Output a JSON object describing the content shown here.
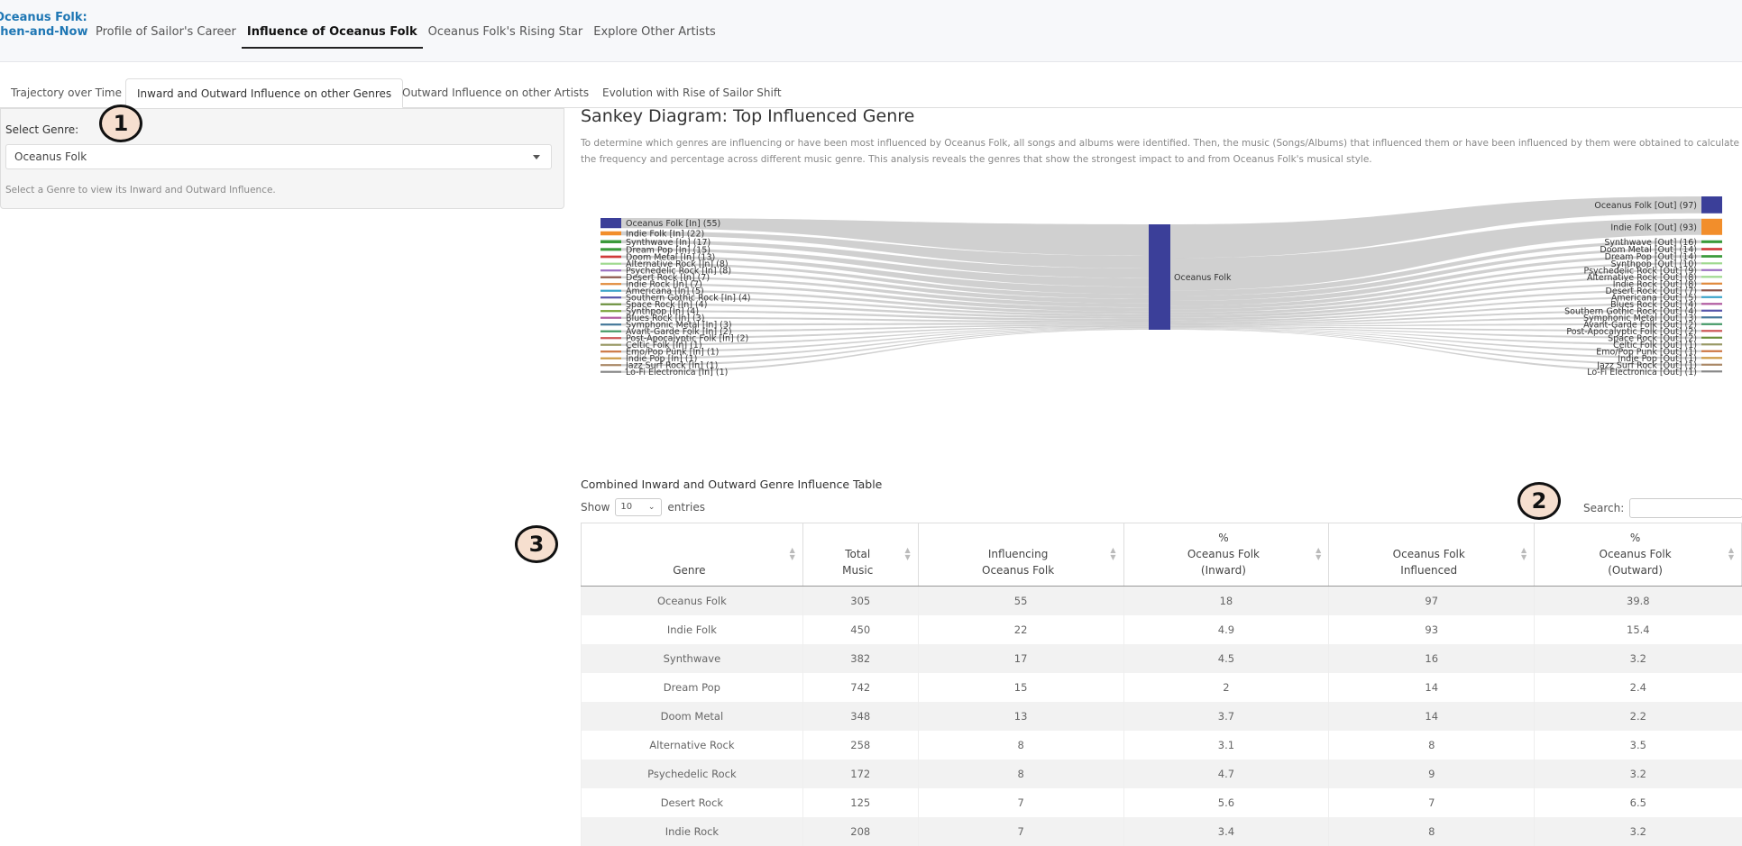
{
  "app": {
    "brand_line1": "Oceanus Folk:",
    "brand_line2": "then-and-Now"
  },
  "nav": [
    {
      "label": "Profile of Sailor's Career"
    },
    {
      "label": "Influence of Oceanus Folk"
    },
    {
      "label": "Oceanus Folk's Rising Star"
    },
    {
      "label": "Explore Other Artists"
    }
  ],
  "subtabs": [
    {
      "label": "Trajectory over Time"
    },
    {
      "label": "Inward and Outward Influence on other Genres"
    },
    {
      "label": "Outward Influence on other Artists"
    },
    {
      "label": "Evolution with Rise of Sailor Shift"
    }
  ],
  "sidebar": {
    "label": "Select Genre:",
    "selected": "Oceanus Folk",
    "help": "Select a Genre to view its Inward and Outward Influence."
  },
  "markers": [
    "1",
    "2",
    "3"
  ],
  "main": {
    "title": "Sankey Diagram: Top Influenced Genre",
    "description": "To determine which genres are influencing or have been most influenced by Oceanus Folk, all songs and albums were identified. Then, the music (Songs/Albums) that influenced them or have been influenced by them were obtained to calculate the frequency and percentage across different music genre. This analysis reveals the genres that show the strongest impact to and from Oceanus Folk's musical style."
  },
  "chart_data": {
    "type": "sankey",
    "center": "Oceanus Folk",
    "center_color": "#3b3f99",
    "inward": [
      {
        "label": "Oceanus Folk [In] (55)",
        "value": 55,
        "color": "#3b3f99"
      },
      {
        "label": "Indie Folk [In] (22)",
        "value": 22,
        "color": "#f28e2b"
      },
      {
        "label": "Synthwave [In] (17)",
        "value": 17,
        "color": "#3a9a3a"
      },
      {
        "label": "Dream Pop [In] (15)",
        "value": 15,
        "color": "#3a9a3a"
      },
      {
        "label": "Doom Metal [In] (13)",
        "value": 13,
        "color": "#d03b3b"
      },
      {
        "label": "Alternative Rock [In] (8)",
        "value": 8,
        "color": "#9fd98f"
      },
      {
        "label": "Psychedelic Rock [In] (8)",
        "value": 8,
        "color": "#9b6fc0"
      },
      {
        "label": "Desert Rock [In] (7)",
        "value": 7,
        "color": "#8c564b"
      },
      {
        "label": "Indie Rock [In] (7)",
        "value": 7,
        "color": "#e08a3c"
      },
      {
        "label": "Americana [In] (5)",
        "value": 5,
        "color": "#3aa3c9"
      },
      {
        "label": "Southern Gothic Rock [In] (4)",
        "value": 4,
        "color": "#5555aa"
      },
      {
        "label": "Space Rock [In] (4)",
        "value": 4,
        "color": "#6a8f3a"
      },
      {
        "label": "Synthpop [In] (4)",
        "value": 4,
        "color": "#7aa23a"
      },
      {
        "label": "Blues Rock [In] (3)",
        "value": 3,
        "color": "#b05aa0"
      },
      {
        "label": "Symphonic Metal [In] (3)",
        "value": 3,
        "color": "#447799"
      },
      {
        "label": "Avant-Garde Folk [In] (2)",
        "value": 2,
        "color": "#449966"
      },
      {
        "label": "Post-Apocalyptic Folk [In] (2)",
        "value": 2,
        "color": "#cc5555"
      },
      {
        "label": "Celtic Folk [In] (1)",
        "value": 1,
        "color": "#999966"
      },
      {
        "label": "Emo/Pop Punk [In] (1)",
        "value": 1,
        "color": "#cc7744"
      },
      {
        "label": "Indie Pop [In] (1)",
        "value": 1,
        "color": "#cc9944"
      },
      {
        "label": "Jazz Surf Rock [In] (1)",
        "value": 1,
        "color": "#aa8866"
      },
      {
        "label": "Lo-Fi Electronica [In] (1)",
        "value": 1,
        "color": "#888888"
      }
    ],
    "outward": [
      {
        "label": "Oceanus Folk [Out] (97)",
        "value": 97,
        "color": "#3b3f99"
      },
      {
        "label": "Indie Folk [Out] (93)",
        "value": 93,
        "color": "#f28e2b"
      },
      {
        "label": "Synthwave [Out] (16)",
        "value": 16,
        "color": "#3a9a3a"
      },
      {
        "label": "Doom Metal [Out] (14)",
        "value": 14,
        "color": "#d03b3b"
      },
      {
        "label": "Dream Pop [Out] (14)",
        "value": 14,
        "color": "#3a9a3a"
      },
      {
        "label": "Synthpop [Out] (10)",
        "value": 10,
        "color": "#9fd98f"
      },
      {
        "label": "Psychedelic Rock [Out] (9)",
        "value": 9,
        "color": "#9b6fc0"
      },
      {
        "label": "Alternative Rock [Out] (8)",
        "value": 8,
        "color": "#9fd98f"
      },
      {
        "label": "Indie Rock [Out] (8)",
        "value": 8,
        "color": "#e08a3c"
      },
      {
        "label": "Desert Rock [Out] (7)",
        "value": 7,
        "color": "#8c564b"
      },
      {
        "label": "Americana [Out] (5)",
        "value": 5,
        "color": "#3aa3c9"
      },
      {
        "label": "Blues Rock [Out] (4)",
        "value": 4,
        "color": "#b05aa0"
      },
      {
        "label": "Southern Gothic Rock [Out] (4)",
        "value": 4,
        "color": "#5555aa"
      },
      {
        "label": "Symphonic Metal [Out] (3)",
        "value": 3,
        "color": "#447799"
      },
      {
        "label": "Avant-Garde Folk [Out] (2)",
        "value": 2,
        "color": "#449966"
      },
      {
        "label": "Post-Apocalyptic Folk [Out] (2)",
        "value": 2,
        "color": "#cc5555"
      },
      {
        "label": "Space Rock [Out] (2)",
        "value": 2,
        "color": "#6a8f3a"
      },
      {
        "label": "Celtic Folk [Out] (1)",
        "value": 1,
        "color": "#999966"
      },
      {
        "label": "Emo/Pop Punk [Out] (1)",
        "value": 1,
        "color": "#cc7744"
      },
      {
        "label": "Indie Pop [Out] (1)",
        "value": 1,
        "color": "#cc9944"
      },
      {
        "label": "Jazz Surf Rock [Out] (1)",
        "value": 1,
        "color": "#aa8866"
      },
      {
        "label": "Lo-Fi Electronica [Out] (1)",
        "value": 1,
        "color": "#888888"
      }
    ]
  },
  "table": {
    "title": "Combined Inward and Outward Genre Influence Table",
    "show_label": "Show",
    "show_value": "10",
    "entries_label": "entries",
    "search_label": "Search:",
    "columns": [
      "Genre",
      "Total\nMusic",
      "Influencing\nOceanus Folk",
      "%\nOceanus Folk\n(Inward)",
      "Oceanus Folk\nInfluenced",
      "%\nOceanus Folk\n(Outward)"
    ],
    "rows": [
      [
        "Oceanus Folk",
        "305",
        "55",
        "18",
        "97",
        "39.8"
      ],
      [
        "Indie Folk",
        "450",
        "22",
        "4.9",
        "93",
        "15.4"
      ],
      [
        "Synthwave",
        "382",
        "17",
        "4.5",
        "16",
        "3.2"
      ],
      [
        "Dream Pop",
        "742",
        "15",
        "2",
        "14",
        "2.4"
      ],
      [
        "Doom Metal",
        "348",
        "13",
        "3.7",
        "14",
        "2.2"
      ],
      [
        "Alternative Rock",
        "258",
        "8",
        "3.1",
        "8",
        "3.5"
      ],
      [
        "Psychedelic Rock",
        "172",
        "8",
        "4.7",
        "9",
        "3.2"
      ],
      [
        "Desert Rock",
        "125",
        "7",
        "5.6",
        "7",
        "6.5"
      ],
      [
        "Indie Rock",
        "208",
        "7",
        "3.4",
        "8",
        "3.2"
      ]
    ]
  }
}
